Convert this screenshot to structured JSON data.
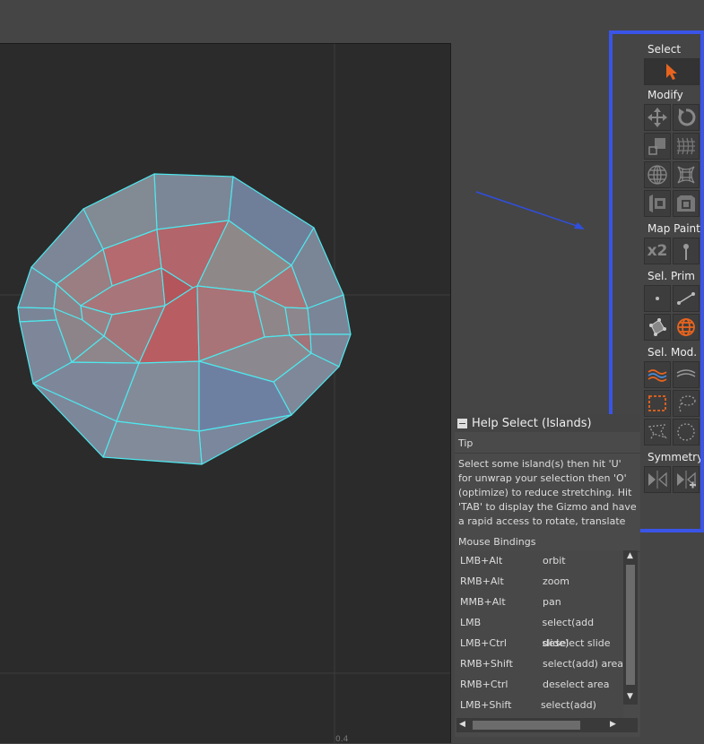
{
  "toolbar": {
    "select_label": "Select",
    "modify_label": "Modify",
    "map_paint_label": "Map Paint",
    "map_paint_x2": "x2",
    "sel_prim_label": "Sel. Prim",
    "sel_mod_label": "Sel. Mod.",
    "symmetry_label": "Symmetry"
  },
  "colors": {
    "active_orange": "#e8641e",
    "highlight_blue": "#3a54e8",
    "mesh_edge": "#4ee8ee"
  },
  "viewport": {
    "axis_tick_label": "0.4"
  },
  "help": {
    "title": "Help Select (Islands)",
    "tip_heading": "Tip",
    "tip_text": "Select some island(s) then hit 'U' for unwrap your selection then 'O' (optimize) to reduce stretching. Hit 'TAB' to display the Gizmo and have a rapid access to rotate, translate and",
    "bindings_heading": "Mouse Bindings",
    "bindings": [
      {
        "key": "LMB+Alt",
        "action": "orbit"
      },
      {
        "key": "RMB+Alt",
        "action": "zoom"
      },
      {
        "key": "MMB+Alt",
        "action": "pan"
      },
      {
        "key": "LMB",
        "action": "select(add slide)"
      },
      {
        "key": "LMB+Ctrl",
        "action": "deselect slide"
      },
      {
        "key": "RMB+Shift",
        "action": "select(add) area"
      },
      {
        "key": "RMB+Ctrl",
        "action": "deselect area"
      },
      {
        "key": "LMB+Shift",
        "action": "select(add) path/"
      }
    ]
  }
}
